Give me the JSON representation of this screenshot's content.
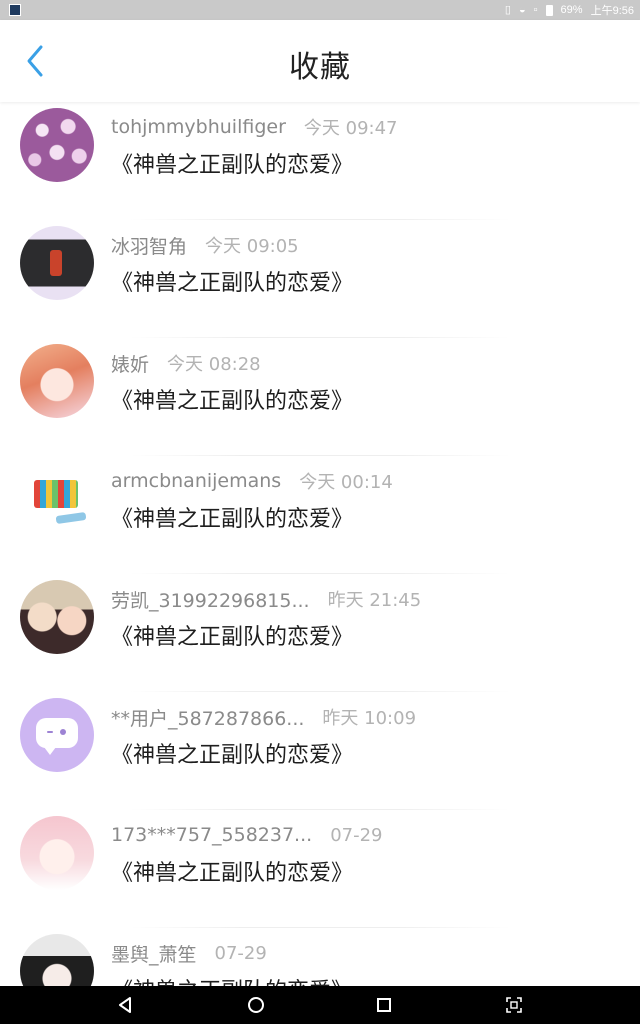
{
  "status_bar": {
    "battery": "69%",
    "time": "上午9:56"
  },
  "header": {
    "title": "收藏"
  },
  "items": [
    {
      "username": "tohjmmybhuilfiger",
      "time": "今天 09:47",
      "title": "《神兽之正副队的恋爱》"
    },
    {
      "username": "冰羽智角",
      "time": "今天 09:05",
      "title": "《神兽之正副队的恋爱》"
    },
    {
      "username": "婊妡",
      "time": "今天 08:28",
      "title": "《神兽之正副队的恋爱》"
    },
    {
      "username": "armcbnanijemans",
      "time": "今天 00:14",
      "title": "《神兽之正副队的恋爱》"
    },
    {
      "username": "劳凯_31992296815...",
      "time": "昨天 21:45",
      "title": "《神兽之正副队的恋爱》"
    },
    {
      "username": "**用户_587287866...",
      "time": "昨天 10:09",
      "title": "《神兽之正副队的恋爱》"
    },
    {
      "username": "173***757_558237...",
      "time": "07-29",
      "title": "《神兽之正副队的恋爱》"
    },
    {
      "username": "墨舆_萧笙",
      "time": "07-29",
      "title": "《神兽之正副队的恋爱》"
    }
  ],
  "colors": {
    "accent": "#3aa0e6",
    "status_bar_bg": "#c9c9c9",
    "nav_bar_bg": "#000000"
  },
  "icons": {
    "back": "chevron-left-icon",
    "nav_back": "triangle-back-icon",
    "nav_home": "circle-home-icon",
    "nav_recents": "square-recents-icon",
    "nav_screenshot": "screenshot-icon"
  }
}
